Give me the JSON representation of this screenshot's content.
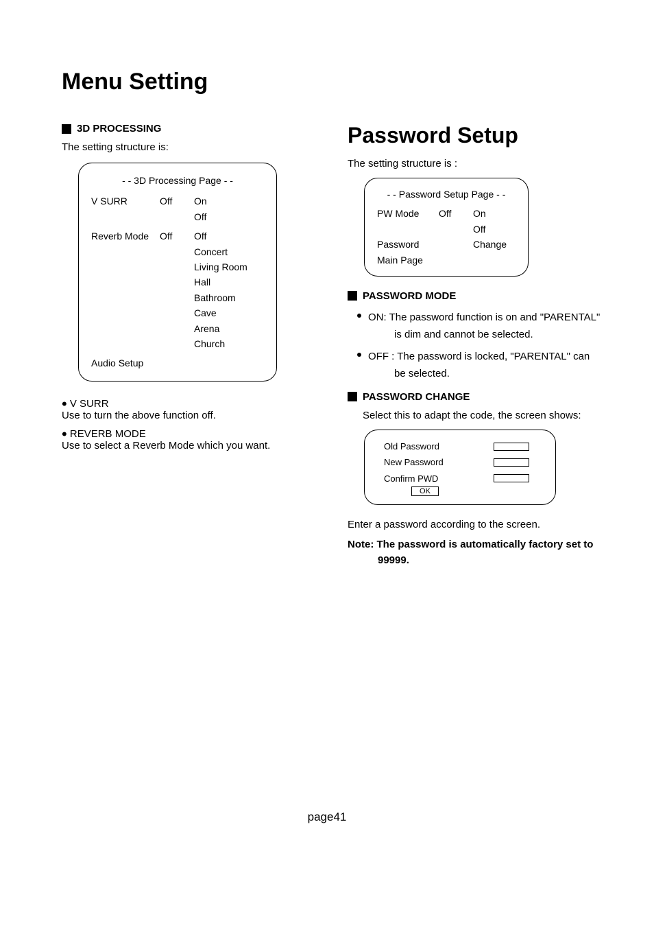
{
  "title": "Menu Setting",
  "left": {
    "heading": "3D PROCESSING",
    "intro": "The setting structure is:",
    "panel": {
      "title": "- - 3D Processing Page - -",
      "vsurr_label": "V SURR",
      "vsurr_val": "Off",
      "vsurr_opts": [
        "On",
        "Off"
      ],
      "reverb_label": "Reverb Mode",
      "reverb_val": "Off",
      "reverb_opts": [
        "Off",
        "Concert",
        "Living Room",
        "Hall",
        "Bathroom",
        "Cave",
        "Arena",
        "Church"
      ],
      "footer": "Audio Setup"
    },
    "b1_label": "V SURR",
    "b1_desc": "Use to turn the above function off.",
    "b2_label": "REVERB MODE",
    "b2_desc": "Use to select a Reverb Mode which you want."
  },
  "right": {
    "heading": "Password Setup",
    "intro": "The setting structure is :",
    "panel": {
      "title": "- - Password Setup Page - -",
      "pw_label": "PW Mode",
      "pw_val": "Off",
      "pw_opts": [
        "On",
        "Off"
      ],
      "pass_label": "Password",
      "pass_val": "Change",
      "main_label": "Main Page"
    },
    "pm_heading": "PASSWORD MODE",
    "pm_on_1": "ON: The password function is on and \"PARENTAL\"",
    "pm_on_2": "is dim and cannot be selected.",
    "pm_off_1": "OFF : The  password  is  locked, \"PARENTAL\" can",
    "pm_off_2": "be selected.",
    "pc_heading": "PASSWORD CHANGE",
    "pc_intro": "Select this to adapt the code, the screen shows:",
    "panel3": {
      "old": "Old Password",
      "new": "New Password",
      "confirm": "Confirm PWD",
      "ok": "OK"
    },
    "enter": "Enter a password according to the screen.",
    "note_1": "Note: The  password  is  automatically factory set to",
    "note_2": "99999."
  },
  "footer": "page41"
}
